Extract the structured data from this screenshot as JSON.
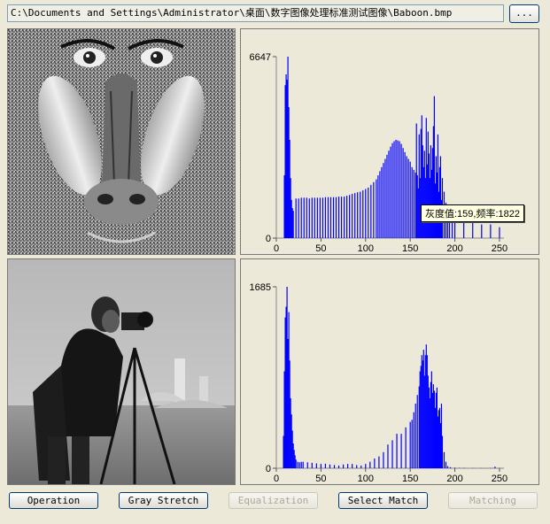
{
  "window": {
    "path": "C:\\Documents and Settings\\Administrator\\桌面\\数字图像处理标准测试图像\\Baboon.bmp",
    "browse_label": "..."
  },
  "images": {
    "top": {
      "name": "Baboon.bmp"
    },
    "bottom": {
      "name": "cameraman"
    }
  },
  "buttons": {
    "operation": "Operation",
    "gray_stretch": "Gray Stretch",
    "equalization": "Equalization",
    "select_match": "Select Match",
    "matching": "Matching"
  },
  "tooltip": {
    "text": "灰度值:159,频率:1822"
  },
  "colors": {
    "histogram": "#0000ff",
    "background": "#ece9d8"
  },
  "chart_data": [
    {
      "type": "bar",
      "title": "",
      "xlabel": "",
      "ylabel": "",
      "xlim": [
        0,
        255
      ],
      "ylim": [
        0,
        6647
      ],
      "x_ticks": [
        "0",
        "50",
        "100",
        "150",
        "200",
        "250"
      ],
      "y_ticks": [
        "0",
        "6647"
      ],
      "x": [
        9,
        10,
        11,
        12,
        13,
        14,
        15,
        16,
        17,
        18,
        19,
        22,
        25,
        28,
        31,
        34,
        37,
        40,
        43,
        46,
        49,
        52,
        55,
        58,
        61,
        64,
        67,
        70,
        73,
        76,
        79,
        82,
        85,
        88,
        91,
        94,
        97,
        100,
        103,
        106,
        109,
        112,
        114,
        116,
        118,
        120,
        122,
        124,
        126,
        128,
        130,
        132,
        134,
        136,
        138,
        140,
        142,
        144,
        146,
        148,
        150,
        152,
        154,
        156,
        157,
        158,
        159,
        160,
        161,
        162,
        163,
        164,
        165,
        166,
        167,
        168,
        169,
        170,
        171,
        172,
        173,
        174,
        175,
        176,
        177,
        178,
        179,
        180,
        181,
        182,
        183,
        184,
        185,
        186,
        188,
        190,
        192,
        194,
        197,
        200,
        210,
        220,
        230,
        240,
        250
      ],
      "values": [
        2300,
        5600,
        6000,
        5800,
        6647,
        4800,
        3600,
        2200,
        1400,
        1100,
        1000,
        1450,
        1450,
        1480,
        1480,
        1480,
        1450,
        1480,
        1480,
        1480,
        1480,
        1480,
        1500,
        1500,
        1500,
        1500,
        1500,
        1520,
        1520,
        1520,
        1550,
        1580,
        1620,
        1650,
        1680,
        1700,
        1750,
        1800,
        1850,
        1950,
        2050,
        2150,
        2300,
        2450,
        2600,
        2750,
        2900,
        3050,
        3200,
        3350,
        3480,
        3550,
        3600,
        3580,
        3550,
        3450,
        3300,
        3150,
        3000,
        2900,
        2800,
        2600,
        2500,
        2400,
        4200,
        2300,
        1822,
        3800,
        2200,
        4000,
        4500,
        3400,
        2600,
        3200,
        2200,
        4400,
        2700,
        3900,
        3100,
        2200,
        3400,
        2500,
        3300,
        4100,
        5200,
        2000,
        3000,
        2400,
        3800,
        1700,
        2600,
        3000,
        1400,
        2200,
        1700,
        1300,
        1000,
        900,
        800,
        700,
        600,
        600,
        500,
        500,
        400
      ]
    },
    {
      "type": "bar",
      "title": "",
      "xlabel": "",
      "ylabel": "",
      "xlim": [
        0,
        255
      ],
      "ylim": [
        0,
        1685
      ],
      "x_ticks": [
        "0",
        "50",
        "100",
        "150",
        "200",
        "250"
      ],
      "y_ticks": [
        "0",
        "1685"
      ],
      "x": [
        8,
        9,
        10,
        11,
        12,
        13,
        14,
        15,
        16,
        17,
        18,
        19,
        20,
        21,
        22,
        24,
        26,
        28,
        30,
        35,
        40,
        45,
        50,
        55,
        60,
        65,
        70,
        75,
        80,
        85,
        90,
        95,
        100,
        105,
        110,
        115,
        120,
        125,
        130,
        135,
        140,
        145,
        150,
        152,
        154,
        156,
        158,
        160,
        161,
        162,
        163,
        164,
        165,
        166,
        167,
        168,
        169,
        170,
        171,
        172,
        173,
        174,
        175,
        176,
        177,
        178,
        179,
        180,
        181,
        182,
        183,
        184,
        185,
        186,
        188,
        190,
        192,
        195,
        200,
        205,
        210,
        220,
        230,
        240,
        245,
        250
      ],
      "values": [
        300,
        900,
        1400,
        1500,
        1685,
        1200,
        1450,
        1000,
        650,
        500,
        350,
        230,
        170,
        120,
        80,
        60,
        55,
        60,
        60,
        55,
        50,
        45,
        40,
        42,
        35,
        30,
        25,
        35,
        40,
        40,
        30,
        25,
        40,
        60,
        90,
        110,
        150,
        220,
        260,
        320,
        320,
        380,
        430,
        450,
        520,
        600,
        680,
        760,
        900,
        950,
        1050,
        1000,
        1100,
        860,
        1050,
        1150,
        1050,
        860,
        750,
        650,
        800,
        900,
        700,
        780,
        720,
        560,
        700,
        750,
        480,
        540,
        560,
        420,
        600,
        300,
        150,
        60,
        20,
        10,
        5,
        3,
        3,
        2,
        2,
        2,
        15,
        3
      ]
    }
  ]
}
